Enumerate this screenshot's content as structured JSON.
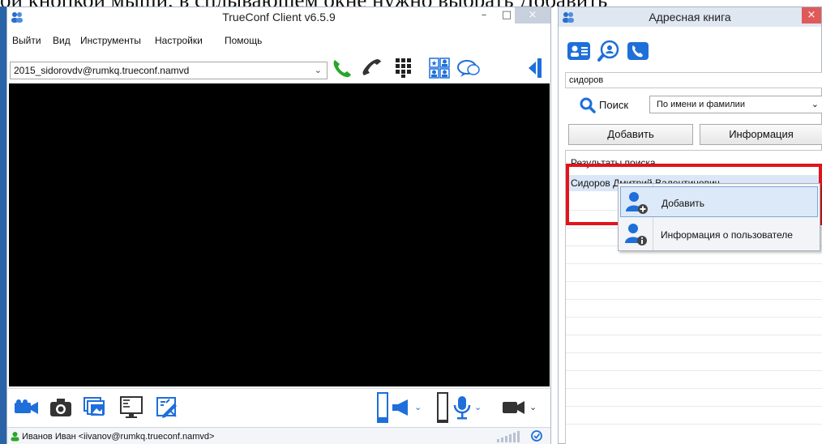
{
  "document": {
    "top_text": "ой кнопкой мыши, в сплывающем окне нужно выбрать Добавить"
  },
  "client": {
    "title": "TrueConf Client v6.5.9",
    "menu": [
      "Выйти",
      "Вид",
      "Инструменты",
      "Настройки",
      "Помощь"
    ],
    "account": "2015_sidorovdv@rumkq.trueconf.namvd",
    "status_user": "Иванов Иван <iivanov@rumkq.trueconf.namvd>"
  },
  "addressbook": {
    "title": "Адресная книга",
    "search_value": "сидоров",
    "search_label": "Поиск",
    "search_mode": "По имени и фамилии",
    "add_label": "Добавить",
    "info_label": "Информация",
    "results_header": "Результаты поиска",
    "results": [
      "Сидоров Дмитрий Валентинович"
    ]
  },
  "context_menu": {
    "items": [
      "Добавить",
      "Информация о пользователе"
    ]
  },
  "colors": {
    "accent_blue": "#1e6fd9",
    "green_call": "#2aa52a",
    "highlight_red": "#e1141c",
    "selection": "#dbe7f7"
  },
  "icons": {
    "toolbar": [
      "call-icon",
      "hangup-icon",
      "dialpad-icon",
      "contacts-grid-icon",
      "chat-icon",
      "collapse-panel-icon"
    ],
    "bottom": [
      "camera-icon",
      "snapshot-icon",
      "slideshow-icon",
      "screen-share-icon",
      "whiteboard-icon",
      "speaker-icon",
      "microphone-icon",
      "video-camera-icon"
    ]
  }
}
